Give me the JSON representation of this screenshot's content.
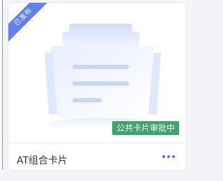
{
  "card": {
    "ribbon_label": "已发布",
    "status_badge": "公共卡片审批中",
    "title": "AT组合卡片",
    "more_icon": "more-horizontal-icon",
    "illustration_icon": "document-stack-icon",
    "colors": {
      "ribbon": "#5f80f2",
      "badge": "#3ea36c",
      "accent": "#6f8ef0"
    }
  }
}
